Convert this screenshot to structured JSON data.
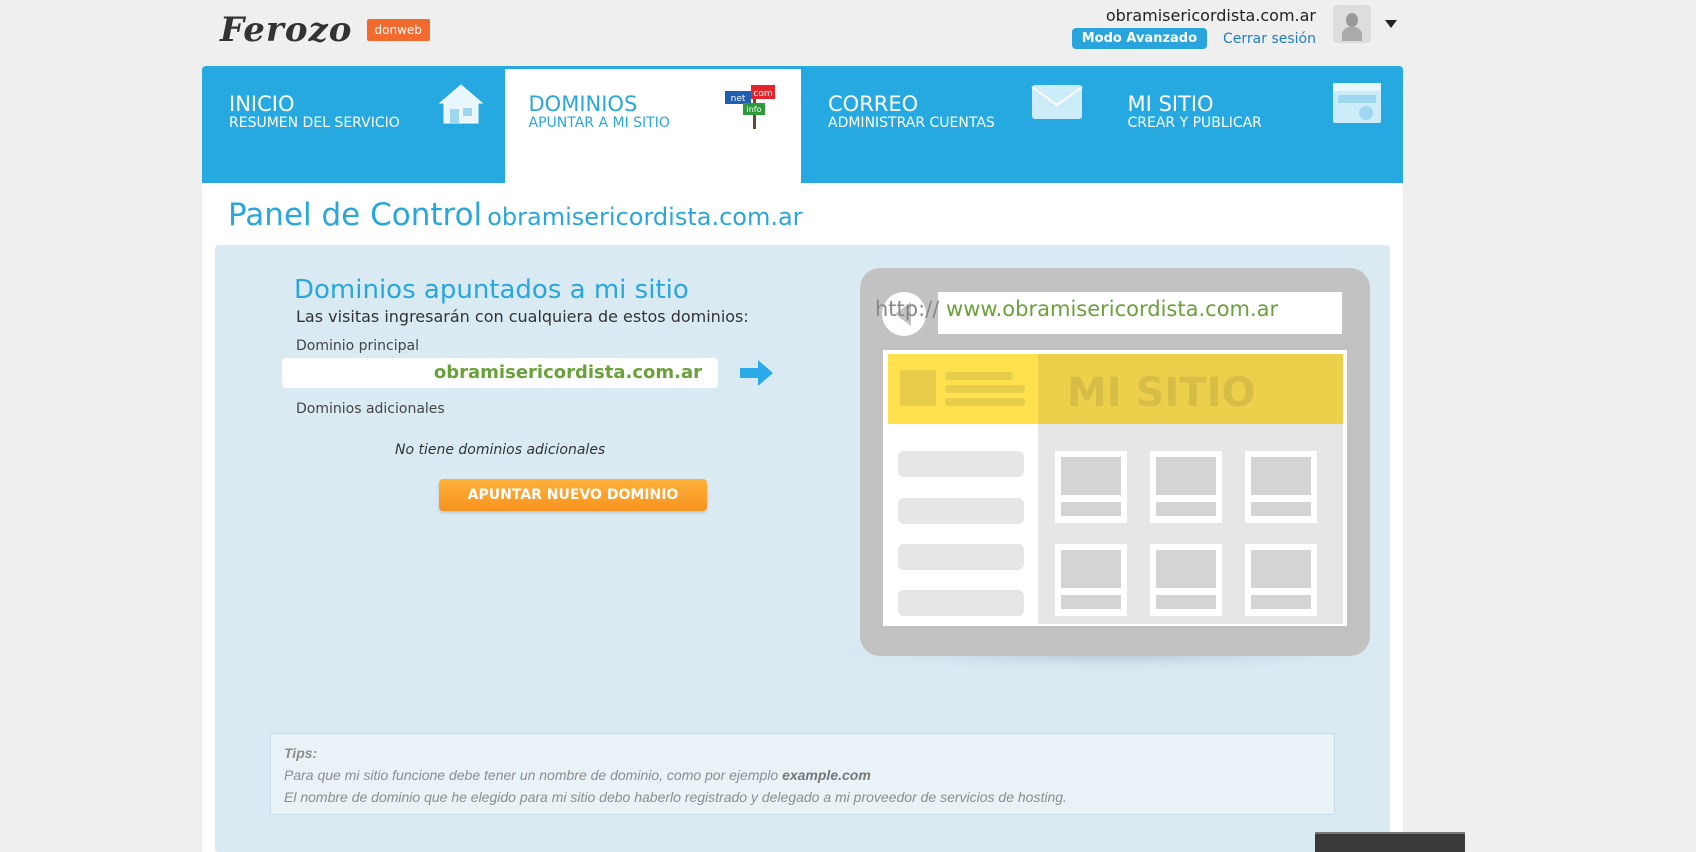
{
  "header": {
    "logo_text": "Ferozo",
    "logo_badge": "donweb",
    "account_domain": "obramisericordista.com.ar",
    "mode_button": "Modo Avanzado",
    "logout_link": "Cerrar sesión"
  },
  "nav": {
    "tabs": [
      {
        "title": "INICIO",
        "subtitle": "RESUMEN DEL SERVICIO",
        "icon": "house-icon",
        "active": false
      },
      {
        "title": "DOMINIOS",
        "subtitle": "APUNTAR A MI SITIO",
        "icon": "domain-signs-icon",
        "active": true
      },
      {
        "title": "CORREO",
        "subtitle": "ADMINISTRAR CUENTAS",
        "icon": "envelope-icon",
        "active": false
      },
      {
        "title": "MI SITIO",
        "subtitle": "CREAR Y PUBLICAR",
        "icon": "browser-window-icon",
        "active": false
      }
    ]
  },
  "panel": {
    "title": "Panel de Control",
    "domain": "obramisericordista.com.ar"
  },
  "domains": {
    "title": "Dominios apuntados a mi sitio",
    "subtitle": "Las visitas ingresarán con cualquiera de estos dominios:",
    "principal_label": "Dominio principal",
    "principal_value": "obramisericordista.com.ar",
    "additional_label": "Dominios adicionales",
    "no_additional": "No tiene dominios adicionales",
    "button_label": "APUNTAR NUEVO DOMINIO"
  },
  "mockup": {
    "url_protocol": "http://",
    "url_domain": "www.obramisericordista.com.ar",
    "site_label": "MI SITIO",
    "icon_labels": [
      "net",
      "com",
      "info"
    ]
  },
  "tips": {
    "title": "Tips:",
    "line1_prefix": "Para que mi sitio funcione debe tener un nombre de dominio, como por ejemplo ",
    "line1_example": "example.com",
    "line2": "El nombre de dominio que he elegido para mi sitio debo haberlo registrado y delegado a mi proveedor de servicios de hosting."
  },
  "colors": {
    "accent": "#26a9e1",
    "orange": "#f7931e",
    "green": "#6aa13a",
    "panel_bg": "#daeaf3"
  }
}
